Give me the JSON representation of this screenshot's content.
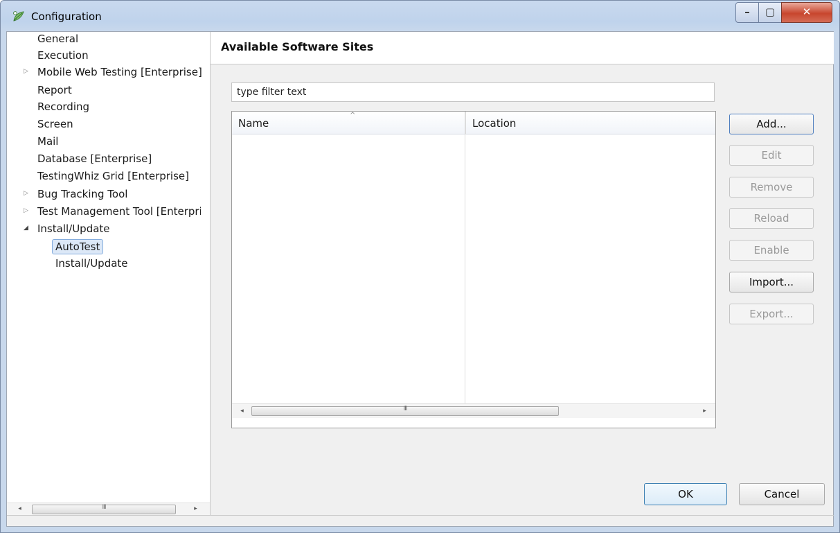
{
  "window": {
    "title": "Configuration",
    "controls": {
      "minimize": "–",
      "maximize": "▢",
      "close": "✕"
    }
  },
  "tree": {
    "items": [
      {
        "label": "General",
        "expander": ""
      },
      {
        "label": "Execution",
        "expander": ""
      },
      {
        "label": "Mobile Web Testing [Enterprise]",
        "expander": "▷"
      },
      {
        "label": "Report",
        "expander": ""
      },
      {
        "label": "Recording",
        "expander": ""
      },
      {
        "label": "Screen",
        "expander": ""
      },
      {
        "label": "Mail",
        "expander": ""
      },
      {
        "label": "Database [Enterprise]",
        "expander": ""
      },
      {
        "label": "TestingWhiz Grid [Enterprise]",
        "expander": ""
      },
      {
        "label": "Bug Tracking Tool",
        "expander": "▷"
      },
      {
        "label": "Test Management Tool [Enterpri:",
        "expander": "▷"
      },
      {
        "label": "Install/Update",
        "expander": "◢"
      },
      {
        "label": "AutoTest",
        "expander": "",
        "selected": true
      },
      {
        "label": "Install/Update",
        "expander": ""
      }
    ],
    "scroll_grip": "III",
    "scroll_left": "◂",
    "scroll_right": "▸"
  },
  "page": {
    "title": "Available Software Sites",
    "filter_value": "type filter text",
    "table": {
      "columns": [
        "Name",
        "Location"
      ],
      "sort_indicator": "^",
      "rows": [],
      "scroll_grip": "III",
      "scroll_left": "◂",
      "scroll_right": "▸"
    },
    "buttons": {
      "add": "Add...",
      "edit": "Edit",
      "remove": "Remove",
      "reload": "Reload",
      "enable": "Enable",
      "import": "Import...",
      "export": "Export..."
    }
  },
  "footer": {
    "ok": "OK",
    "cancel": "Cancel"
  }
}
